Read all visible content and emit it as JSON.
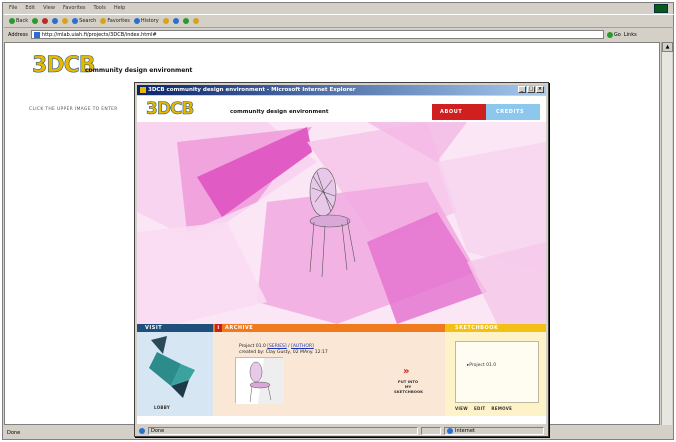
{
  "browser": {
    "menu": [
      "File",
      "Edit",
      "View",
      "Favorites",
      "Tools",
      "Help"
    ],
    "toolbar": {
      "back": "Back",
      "search": "Search",
      "favorites": "Favorites",
      "history": "History"
    },
    "address": {
      "label": "Address",
      "url": "http://mlab.uiah.fi/projects/3DCB/index.html#",
      "go": "Go",
      "links": "Links"
    },
    "status": {
      "done": "Done"
    }
  },
  "site": {
    "logo": "3DCB",
    "tagline": "community design environment",
    "enter_hint": "CLICK THE UPPER IMAGE TO ENTER"
  },
  "popup": {
    "title": "3DCB community design environment - Microsoft Internet Explorer",
    "window_buttons": [
      "_",
      "□",
      "×"
    ],
    "logo": "3DCB",
    "tagline": "community design environment",
    "nav": {
      "about": "ABOUT",
      "credits": "CREDITS"
    },
    "visit": {
      "header": "VISIT",
      "lobby": "LOBBY"
    },
    "archive": {
      "header": "ARCHIVE",
      "info_icon": "i",
      "project_line_prefix": "Project 01.0",
      "series_link": "[SERIES]",
      "sep": "/",
      "author_link": "[AUTHOR]",
      "created_line": "created by: Clay Gusty, 02 MAny. 12:17",
      "put_arrows": "»",
      "put_label": "PUT INTO MY SKETCHBOOK"
    },
    "sketchbook": {
      "header": "SKETCHBOOK",
      "item": "Project 01.0",
      "actions": [
        "VIEW",
        "EDIT",
        "REMOVE"
      ]
    },
    "status": {
      "done": "Done",
      "zone": "Internet"
    }
  },
  "colors": {
    "about_red": "#d01f1f",
    "credits_blue": "#8cc8ee",
    "visit_navy": "#1f4f7a",
    "archive_orange": "#f07b1e",
    "sketch_yellow": "#f3c017",
    "scene_magenta": "#e06ad0"
  }
}
